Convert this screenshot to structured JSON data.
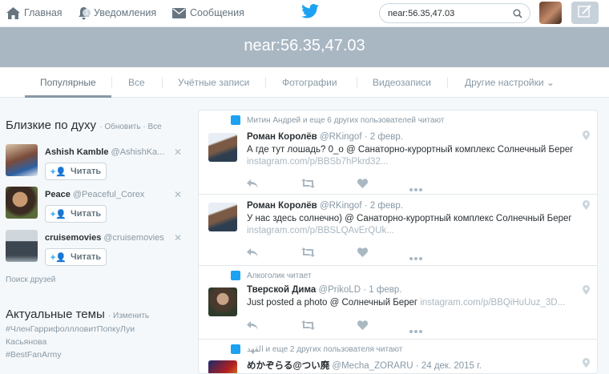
{
  "nav": {
    "home": "Главная",
    "notifications": "Уведомления",
    "notifications_count": "1",
    "messages": "Сообщения"
  },
  "search": {
    "value": "near:56.35,47.03"
  },
  "banner": {
    "title": "near:56.35,47.03"
  },
  "tabs": [
    "Популярные",
    "Все",
    "Учётные записи",
    "Фотографии",
    "Видеозаписи",
    "Другие настройки"
  ],
  "who_to_follow": {
    "title": "Близкие по духу",
    "refresh": "Обновить",
    "all": "Все",
    "follow_label": "Читать",
    "find_friends": "Поиск друзей",
    "users": [
      {
        "name": "Ashish Kamble",
        "handle": "@AshishKa..."
      },
      {
        "name": "Peace",
        "handle": "@Peaceful_Corex"
      },
      {
        "name": "cruisemovies",
        "handle": "@cruisemovies"
      }
    ]
  },
  "trends": {
    "title": "Актуальные темы",
    "change": "Изменить",
    "items": [
      "#ЧленГаррифоллловитПопкуЛуи",
      "Касьянова",
      "#BestFanArmy"
    ]
  },
  "tweets": [
    {
      "context": "Митин Андрей и еще 6 других пользователей читают",
      "name": "Роман Королёв",
      "handle": "@RKingof",
      "date": "2 февр.",
      "text": "А где тут лошадь? 0_о @ Санаторно-курортный комплекс Солнечный Берег",
      "link": "instagram.com/p/BBSb7hPkrd32..."
    },
    {
      "context": "",
      "name": "Роман Королёв",
      "handle": "@RKingof",
      "date": "2 февр.",
      "text": "У нас здесь солнечно) @ Санаторно-курортный комплекс Солнечный Берег",
      "link": "instagram.com/p/BBSLQAvErQUk..."
    },
    {
      "context": "Алкоголик читает",
      "name": "Тверской Дима",
      "handle": "@PrikoLD",
      "date": "1 февр.",
      "text": "Just posted a photo @ Солнечный Берег",
      "link": "instagram.com/p/BBQiHuUuz_3D..."
    },
    {
      "context": "القهد и еще 2 других пользователя читают",
      "name": "めかぞらる@つい廃",
      "handle": "@Mecha_ZORARU",
      "date": "24 дек. 2015 г."
    }
  ],
  "colors": {
    "accent": "#1da1f2",
    "banner": "#a9b7c3",
    "muted": "#8899a6"
  }
}
